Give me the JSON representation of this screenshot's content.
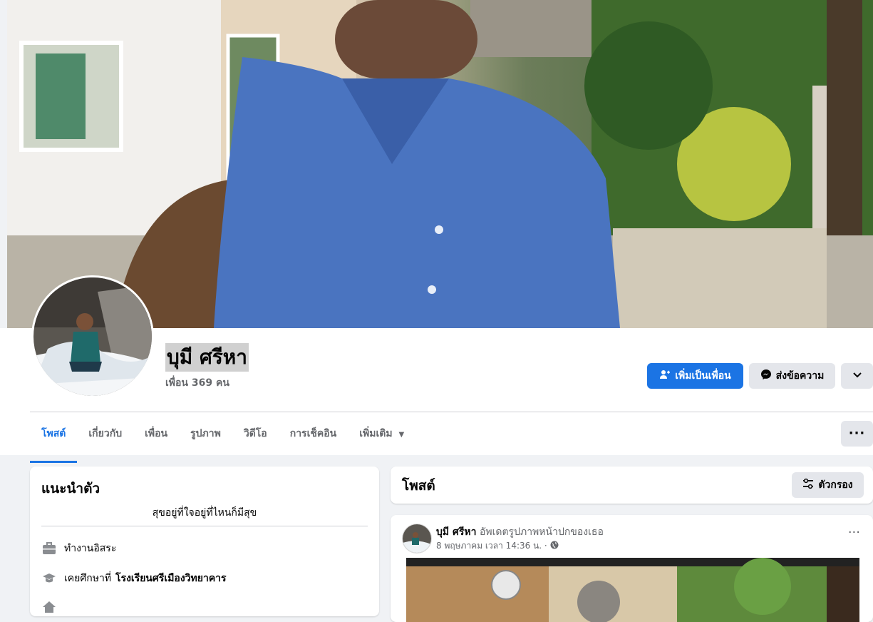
{
  "profile": {
    "name": "บุมี ศรีหา",
    "friends_count": "เพื่อน 369 คน"
  },
  "actions": {
    "add_friend": "เพิ่มเป็นเพื่อน",
    "message": "ส่งข้อความ"
  },
  "tabs": [
    {
      "label": "โพสต์"
    },
    {
      "label": "เกี่ยวกับ"
    },
    {
      "label": "เพื่อน"
    },
    {
      "label": "รูปภาพ"
    },
    {
      "label": "วิดีโอ"
    },
    {
      "label": "การเช็คอิน"
    },
    {
      "label": "เพิ่มเติม"
    }
  ],
  "intro": {
    "title": "แนะนำตัว",
    "bio": "สุขอยู่ที่ใจอยู่ที่ไหนก็มีสุข",
    "work": "ทำงานอิสระ",
    "education_prefix": "เคยศึกษาที่",
    "education_school": "โรงเรียนศรีเมืองวิทยาคาร"
  },
  "posts": {
    "title": "โพสต์",
    "filter_label": "ตัวกรอง",
    "first": {
      "author": "บุมี ศรีหา",
      "action": "อัพเดตรูปภาพหน้าปกของเธอ",
      "timestamp": "8 พฤษภาคม เวลา 14:36 น. ·"
    }
  },
  "colors": {
    "accent": "#1b74e4",
    "background": "#f0f2f5"
  }
}
